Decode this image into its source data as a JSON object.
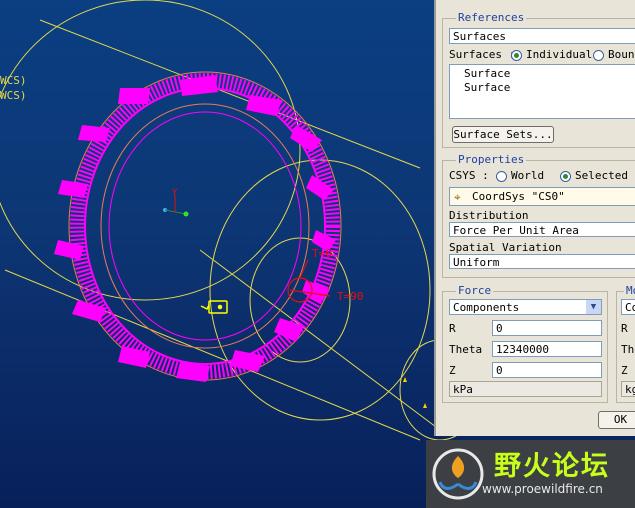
{
  "viewport": {
    "background_top": "#0a3f82",
    "csys_labels": [
      "WCS)",
      "WCS)"
    ],
    "theta_labels": [
      "T=0",
      "T=90"
    ],
    "axis_label": "Y",
    "colors": {
      "load_arrows": "#ff00ff",
      "edges": "#e6d84a",
      "csys_red": "#e01010"
    }
  },
  "panel": {
    "references": {
      "title": "References",
      "selection_type": "Surfaces",
      "surfaces_label": "Surfaces :",
      "individual_label": "Individual",
      "boundary_label": "Boun",
      "surface_list": [
        "Surface",
        "Surface"
      ],
      "surface_sets_button": "Surface Sets..."
    },
    "properties": {
      "title": "Properties",
      "csys_label": "CSYS :",
      "world_label": "World",
      "selected_label": "Selected",
      "coord_sys_value": "CoordSys \"CS0\"",
      "distribution_label": "Distribution",
      "distribution_value": "Force Per Unit Area",
      "spatial_label": "Spatial Variation",
      "spatial_value": "Uniform"
    },
    "force": {
      "title": "Force",
      "type_value": "Components",
      "r_label": "R",
      "r_value": "0",
      "theta_label": "Theta",
      "theta_value": "12340000",
      "z_label": "Z",
      "z_value": "0",
      "units": "kPa"
    },
    "moment": {
      "title": "Mo",
      "type_value": "Com",
      "r_label": "R",
      "theta_label": "The",
      "z_label": "Z",
      "units": "kg"
    },
    "ok_button": "OK"
  },
  "watermark": {
    "title": "野火论坛",
    "url": "www.proewildfire.cn"
  }
}
